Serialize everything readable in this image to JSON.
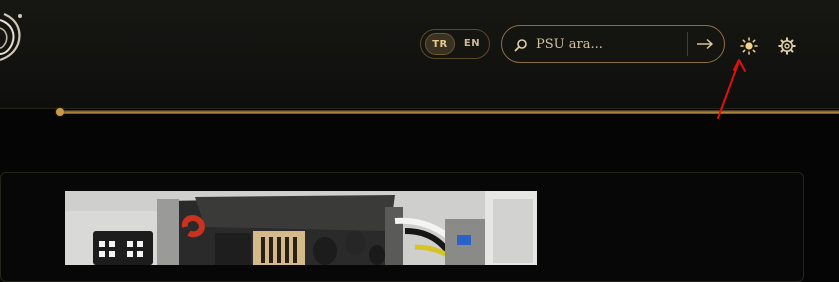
{
  "header": {
    "lang": {
      "tr_label": "TR",
      "en_label": "EN",
      "selected": "TR"
    },
    "search": {
      "placeholder": "PSU ara..."
    },
    "icons": {
      "search": "search-icon",
      "submit": "arrow-right-icon",
      "theme": "sun-icon",
      "settings": "gear-icon",
      "logo": "logo-emblem"
    }
  },
  "colors": {
    "accent_gold": "#b48a42",
    "header_bg": "#141410",
    "page_bg": "#050505",
    "annotation_red": "#e01010"
  },
  "main": {
    "image": {
      "icon": "psu-internals-photo"
    }
  }
}
